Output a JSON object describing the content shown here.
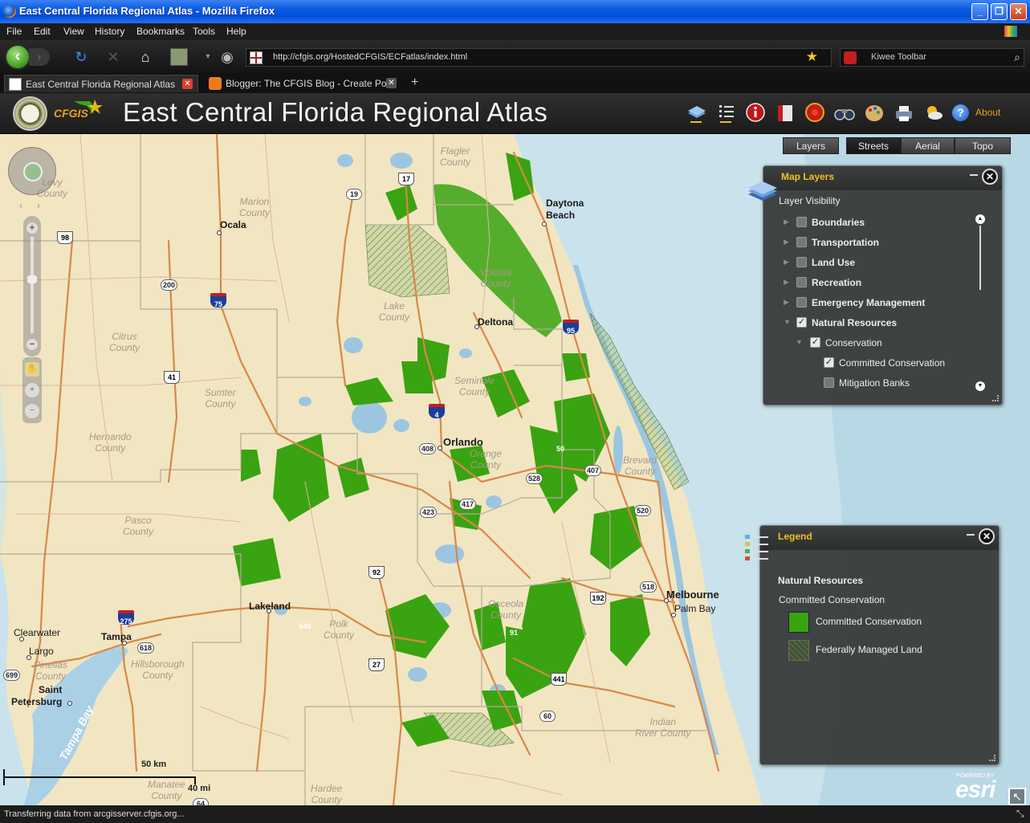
{
  "browser": {
    "window_title": "East Central Florida Regional Atlas - Mozilla Firefox",
    "menu": [
      "File",
      "Edit",
      "View",
      "History",
      "Bookmarks",
      "Tools",
      "Help"
    ],
    "url": "http://cfgis.org/HostedCFGIS/ECFatlas/index.html",
    "search_placeholder": "Kiwee Toolbar",
    "tabs": [
      {
        "label": "East Central Florida Regional Atlas",
        "active": true
      },
      {
        "label": "Blogger: The CFGIS Blog - Create Post",
        "active": false
      }
    ],
    "status": "Transferring data from arcgisserver.cfgis.org..."
  },
  "app": {
    "logo_text": "CFGIS",
    "title": "East Central Florida Regional Atlas",
    "tools": [
      "layers-icon",
      "legend-list-icon",
      "info-icon",
      "bookmark-book-icon",
      "record-icon",
      "binoculars-icon",
      "palette-icon",
      "print-icon",
      "weather-icon"
    ],
    "about_label": "About"
  },
  "basemaps": {
    "layers_label": "Layers",
    "options": [
      "Streets",
      "Aerial",
      "Topo"
    ],
    "selected": "Streets"
  },
  "map_layers_panel": {
    "title": "Map Layers",
    "subtitle": "Layer Visibility",
    "rows": [
      {
        "label": "Boundaries",
        "checked": false,
        "expanded": false,
        "level": 0
      },
      {
        "label": "Transportation",
        "checked": false,
        "expanded": false,
        "level": 0
      },
      {
        "label": "Land Use",
        "checked": false,
        "expanded": false,
        "level": 0
      },
      {
        "label": "Recreation",
        "checked": false,
        "expanded": false,
        "level": 0
      },
      {
        "label": "Emergency Management",
        "checked": false,
        "expanded": false,
        "level": 0
      },
      {
        "label": "Natural Resources",
        "checked": true,
        "expanded": true,
        "level": 0
      },
      {
        "label": "Conservation",
        "checked": true,
        "expanded": true,
        "level": 1
      },
      {
        "label": "Committed Conservation",
        "checked": true,
        "level": 2
      },
      {
        "label": "Mitigation Banks",
        "checked": false,
        "level": 2
      }
    ]
  },
  "legend_panel": {
    "title": "Legend",
    "group": "Natural Resources",
    "layer": "Committed Conservation",
    "items": [
      {
        "label": "Committed Conservation",
        "color": "#3aa311",
        "pattern": "solid"
      },
      {
        "label": "Federally Managed Land",
        "color": "#5d7a3a",
        "pattern": "hatch"
      }
    ]
  },
  "map": {
    "cities": [
      "Ocala",
      "Daytona Beach",
      "Deltona",
      "Orlando",
      "Lakeland",
      "Tampa",
      "Clearwater",
      "Largo",
      "Saint Petersburg",
      "Melbourne",
      "Palm Bay"
    ],
    "city_lines": {
      "daytona": [
        "Daytona",
        "Beach"
      ],
      "saint_pete": [
        "Saint",
        "Petersburg"
      ]
    },
    "counties": [
      [
        "Flagler",
        "County"
      ],
      [
        "Levy",
        "County"
      ],
      [
        "Marion",
        "County"
      ],
      [
        "Volusia",
        "County"
      ],
      [
        "Lake",
        "County"
      ],
      [
        "Citrus",
        "County"
      ],
      [
        "Seminole",
        "County"
      ],
      [
        "Sumter",
        "County"
      ],
      [
        "Orange",
        "County"
      ],
      [
        "Brevard",
        "County"
      ],
      [
        "Hernando",
        "County"
      ],
      [
        "Pasco",
        "County"
      ],
      [
        "Osceola",
        "County"
      ],
      [
        "Polk",
        "County"
      ],
      [
        "Pinellas",
        "County"
      ],
      [
        "Hillsborough",
        "County"
      ],
      [
        "Indian",
        "River County"
      ],
      [
        "Manatee",
        "County"
      ],
      [
        "Hardee",
        "County"
      ]
    ],
    "water_label": "Tampa Bay",
    "routes": [
      "17",
      "19",
      "98",
      "200",
      "75",
      "95",
      "41",
      "4",
      "408",
      "50",
      "407",
      "528",
      "520",
      "417",
      "423",
      "92",
      "518",
      "192",
      "275",
      "618",
      "699",
      "27",
      "441",
      "91",
      "60",
      "540",
      "64"
    ],
    "scale": {
      "km": "50 km",
      "mi": "40 mi"
    },
    "attribution_top": "POWERED BY",
    "attribution": "esri"
  }
}
